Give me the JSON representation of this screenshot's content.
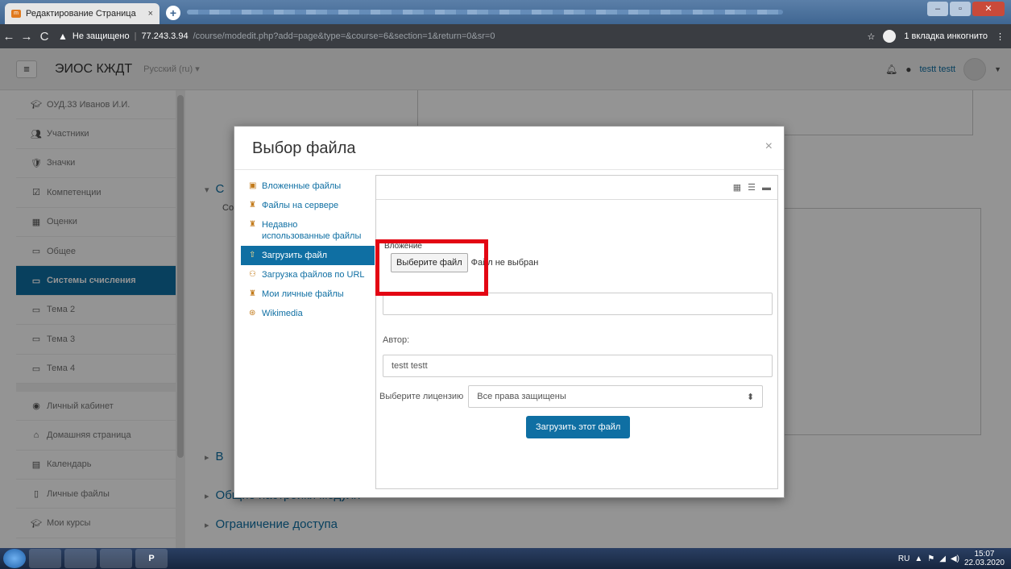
{
  "browser": {
    "tab_title": "Редактирование Страница",
    "tab_close": "×",
    "new_tab": "+",
    "insecure_label": "Не защищено",
    "separator": "|",
    "host": "77.243.3.94",
    "path": "/course/modedit.php?add=page&type=&course=6&section=1&return=0&sr=0",
    "incognito_label": "1 вкладка инкогнито"
  },
  "navbar": {
    "brand": "ЭИОС КЖДТ",
    "language": "Русский (ru) ▾",
    "username": "testt testt"
  },
  "sidebar": {
    "items": [
      {
        "label": "ОУД.33 Иванов И.И.",
        "icon": "graduation-cap-icon",
        "active": false
      },
      {
        "label": "Участники",
        "icon": "users-icon",
        "active": false
      },
      {
        "label": "Значки",
        "icon": "badge-icon",
        "active": false
      },
      {
        "label": "Компетенции",
        "icon": "checkbox-icon",
        "active": false
      },
      {
        "label": "Оценки",
        "icon": "table-icon",
        "active": false
      },
      {
        "label": "Общее",
        "icon": "folder-icon",
        "active": false
      },
      {
        "label": "Системы счисления",
        "icon": "folder-icon",
        "active": true
      },
      {
        "label": "Тема 2",
        "icon": "folder-icon",
        "active": false
      },
      {
        "label": "Тема 3",
        "icon": "folder-icon",
        "active": false
      },
      {
        "label": "Тема 4",
        "icon": "folder-icon",
        "active": false
      }
    ],
    "items2": [
      {
        "label": "Личный кабинет",
        "icon": "dashboard-icon"
      },
      {
        "label": "Домашняя страница",
        "icon": "home-icon"
      },
      {
        "label": "Календарь",
        "icon": "calendar-icon"
      },
      {
        "label": "Личные файлы",
        "icon": "file-icon"
      },
      {
        "label": "Мои курсы",
        "icon": "graduation-cap-icon"
      }
    ]
  },
  "main": {
    "section_partial_1": "С",
    "section_partial_2": "Со",
    "section_partial_3": "В",
    "section_general": "Общие настройки модуля",
    "section_restrict": "Ограничение доступа"
  },
  "modal": {
    "title": "Выбор файла",
    "close": "×",
    "repos": [
      {
        "label": "Вложенные файлы",
        "icon": "attachment-icon",
        "selected": false
      },
      {
        "label": "Файлы на сервере",
        "icon": "server-files-icon",
        "selected": false
      },
      {
        "label": "Недавно использованные файлы",
        "icon": "recent-files-icon",
        "selected": false
      },
      {
        "label": "Загрузить файл",
        "icon": "upload-icon",
        "selected": true
      },
      {
        "label": "Загрузка файлов по URL",
        "icon": "url-icon",
        "selected": false
      },
      {
        "label": "Мои личные файлы",
        "icon": "private-files-icon",
        "selected": false
      },
      {
        "label": "Wikimedia",
        "icon": "wikimedia-icon",
        "selected": false
      }
    ],
    "toolbar": [
      "▦",
      "☰",
      "▬"
    ],
    "attach_label": "Вложение",
    "file_button": "Выберите файл",
    "file_status": "Файл не выбран",
    "save_as_value": "",
    "author_label": "Автор:",
    "author_value": "testt testt",
    "licence_label": "Выберите лицензию",
    "licence_value": "Все права защищены",
    "upload_button": "Загрузить этот файл"
  },
  "taskbar": {
    "lang": "RU",
    "time": "15:07",
    "date": "22.03.2020",
    "apps": [
      "",
      "",
      "",
      "P"
    ]
  },
  "colors": {
    "accent": "#0f6fa3",
    "highlight": "#e30613"
  }
}
